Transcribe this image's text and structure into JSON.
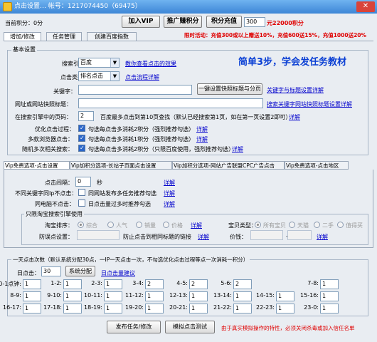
{
  "window": {
    "title": "点击设置…  帐号：1217074450（69475）",
    "close": "✕"
  },
  "header": {
    "points_label": "当前积分：0分",
    "add_vip": "加入VIP",
    "promote": "推广赚积分",
    "recharge": "积分充值",
    "recharge_amount": "300",
    "recharge_note": "元22000积分",
    "promo": "限时活动：充值300或以上赠送10%，充值600送15%，充值1000送20%"
  },
  "tabs": [
    "增加/修改",
    "任务管理",
    "创建百度指数"
  ],
  "basic": {
    "title": "基本设置",
    "slogan": "简单3步，学会发任务教材",
    "engine_label": "搜索引擎：",
    "engine_value": "百度",
    "engine_link": "教你查看点击的效果",
    "click_type_label": "点击类型：",
    "click_type_value": "排名点击",
    "click_type_link": "点击流程详解",
    "keyword_label": "关键字：",
    "keyword_button": "一键设置快照标题与分页",
    "keyword_link": "关键字与标题设置详解",
    "url_label": "网址或网站快照标题：",
    "url_link": "搜索关键字网站快照标题设置详解",
    "page_label": "在搜索引擎中的页码：",
    "page_value": "2",
    "page_note": "百度最多点击到第10页查找（默认已经搜索第1页，如在第一页设置2即可）",
    "page_link": "详解",
    "opt1_label": "优化点击过程：",
    "opt1_text": "勾选每点击多消耗2积分（强烈推荐勾选）",
    "opt1_link": "详解",
    "opt2_label": "多款浏览器点击：",
    "opt2_text": "勾选每点击多消耗1积分（强烈推荐勾选）",
    "opt2_link": "详解",
    "opt3_label": "随机多次相关搜索：",
    "opt3_text": "勾选每点击多消耗2积分（只限百度使用，强烈推荐勾选）",
    "opt3_link": "详解"
  },
  "subtabs": [
    "Vip免费选项-点击设置",
    "Vip加积分选项-长站子页面点击设置",
    "Vip加积分选项-网站广告联盟CPC广告点击",
    "Vip免费选项-点击地区"
  ],
  "vip": {
    "interval_label": "点击间隔：",
    "interval_value": "0",
    "interval_unit": "秒",
    "interval_link": "详解",
    "ip_label": "不同关键字同Ip不点击：",
    "ip_text": "同网站发布多任务推荐勾选",
    "ip_link": "详解",
    "pc_label": "同电脑不点击：",
    "pc_text": "日点击量过多时推荐勾选",
    "pc_link": "详解",
    "taobao_title": "只限淘宝搜索引擎使用",
    "taobao_sort_label": "淘宝排序：",
    "taobao_sorts": [
      "综合",
      "人气",
      "销量",
      "价格"
    ],
    "taobao_link": "详解",
    "anti_label": "防误点设置：",
    "anti_text": "防止点击到相同标题的链接",
    "anti_link": "详解",
    "baby_label": "宝贝类型：",
    "baby_types": [
      "所有宝贝",
      "天猫",
      "二手",
      "值得买"
    ],
    "price_label": "价钱：",
    "price_sep": "—",
    "price_link": "详解"
  },
  "schedule": {
    "title": "一天点击次数（默认系统分配30点，一IP一天点击一次，不勾选优化点击过程等点一次消耗一积分）",
    "daily_label": "日点击：",
    "daily_value": "30",
    "distribute_button": "系统分配",
    "daily_link": "日点击量建议",
    "hours": [
      {
        "label": "0-1点钟:",
        "value": "1"
      },
      {
        "label": "1-2:",
        "value": "1"
      },
      {
        "label": "2-3:",
        "value": "1"
      },
      {
        "label": "3-4:",
        "value": "2"
      },
      {
        "label": "4-5:",
        "value": "2"
      },
      {
        "label": "5-6:",
        "value": "2"
      },
      {
        "label": "7-8:",
        "value": "1"
      },
      {
        "label": "8-9:",
        "value": "1"
      },
      {
        "label": "9-10:",
        "value": "1"
      },
      {
        "label": "10-11:",
        "value": "1"
      },
      {
        "label": "11-12:",
        "value": "1"
      },
      {
        "label": "12-13:",
        "value": "1"
      },
      {
        "label": "13-14:",
        "value": "1"
      },
      {
        "label": "14-15:",
        "value": "1"
      },
      {
        "label": "15-16:",
        "value": "1"
      },
      {
        "label": "16-17:",
        "value": "1"
      },
      {
        "label": "17-18:",
        "value": "1"
      },
      {
        "label": "18-19:",
        "value": "1"
      },
      {
        "label": "19-20:",
        "value": "1"
      },
      {
        "label": "20-21:",
        "value": "1"
      },
      {
        "label": "21-22:",
        "value": "1"
      },
      {
        "label": "22-23:",
        "value": "1"
      },
      {
        "label": "23-0:",
        "value": "1"
      }
    ]
  },
  "footer": {
    "publish": "发布任务/修改",
    "simulate": "模拟点击测试",
    "note": "由于真实模拟操作的特性，必须关闭杀毒或加入信任名单"
  },
  "colors": {
    "accent_red": "#e00000",
    "link_blue": "#0000cc",
    "title_blue": "#3d86d6"
  }
}
